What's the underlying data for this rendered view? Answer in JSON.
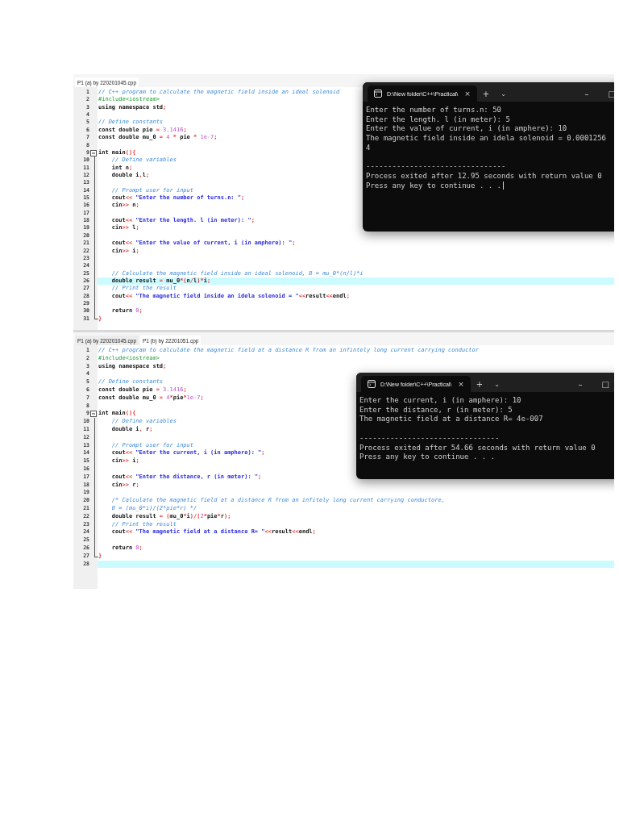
{
  "editors": [
    {
      "tabs": [
        {
          "label": "P1 (a) by 220201045.cpp",
          "selected": true
        }
      ],
      "lines": [
        {
          "number": "1",
          "highlighted": false,
          "segments": [
            {
              "kind": "comment",
              "text": "// C++ program to calculate the magnetic field inside an ideal solenoid"
            }
          ]
        },
        {
          "number": "2",
          "highlighted": false,
          "segments": [
            {
              "kind": "pre",
              "text": "#include<iostream>"
            }
          ]
        },
        {
          "number": "3",
          "highlighted": false,
          "segments": [
            {
              "kind": "plain",
              "text": "using namespace std"
            },
            {
              "kind": "op",
              "text": ";"
            }
          ]
        },
        {
          "number": "4",
          "highlighted": false
        },
        {
          "number": "5",
          "highlighted": false,
          "segments": [
            {
              "kind": "comment",
              "text": "// Define constants"
            }
          ]
        },
        {
          "number": "6",
          "highlighted": false,
          "segments": [
            {
              "kind": "plain",
              "text": "const double pie "
            },
            {
              "kind": "op",
              "text": "="
            },
            {
              "kind": "num",
              "text": " 3.1416"
            },
            {
              "kind": "op",
              "text": ";"
            }
          ]
        },
        {
          "number": "7",
          "highlighted": false,
          "segments": [
            {
              "kind": "plain",
              "text": "const double mu_0 "
            },
            {
              "kind": "op",
              "text": "="
            },
            {
              "kind": "num",
              "text": " 4 "
            },
            {
              "kind": "op",
              "text": "*"
            },
            {
              "kind": "plain",
              "text": " pie "
            },
            {
              "kind": "op",
              "text": "*"
            },
            {
              "kind": "num",
              "text": " 1e-7"
            },
            {
              "kind": "op",
              "text": ";"
            }
          ]
        },
        {
          "number": "8",
          "highlighted": false
        },
        {
          "number": "9",
          "highlighted": false,
          "kind": "fold_start",
          "segments": [
            {
              "kind": "plain",
              "text": "int main"
            },
            {
              "kind": "op",
              "text": "(){"
            }
          ]
        },
        {
          "number": "10",
          "highlighted": false,
          "segments": [
            {
              "kind": "comment",
              "text": "    // Define variables"
            }
          ]
        },
        {
          "number": "11",
          "highlighted": false,
          "segments": [
            {
              "kind": "plain",
              "text": "    int n"
            },
            {
              "kind": "op",
              "text": ";"
            }
          ]
        },
        {
          "number": "12",
          "highlighted": false,
          "segments": [
            {
              "kind": "plain",
              "text": "    double i"
            },
            {
              "kind": "op",
              "text": ","
            },
            {
              "kind": "plain",
              "text": "l"
            },
            {
              "kind": "op",
              "text": ";"
            }
          ]
        },
        {
          "number": "13",
          "highlighted": false
        },
        {
          "number": "14",
          "highlighted": false,
          "segments": [
            {
              "kind": "comment",
              "text": "    // Prompt user for input"
            }
          ]
        },
        {
          "number": "15",
          "highlighted": false,
          "segments": [
            {
              "kind": "plain",
              "text": "    cout"
            },
            {
              "kind": "op",
              "text": "<<"
            },
            {
              "kind": "str",
              "text": " \"Enter the number of turns.n: \""
            },
            {
              "kind": "op",
              "text": ";"
            }
          ]
        },
        {
          "number": "16",
          "highlighted": false,
          "segments": [
            {
              "kind": "plain",
              "text": "    cin"
            },
            {
              "kind": "op",
              "text": ">>"
            },
            {
              "kind": "plain",
              "text": " n"
            },
            {
              "kind": "op",
              "text": ";"
            }
          ]
        },
        {
          "number": "17",
          "highlighted": false
        },
        {
          "number": "18",
          "highlighted": false,
          "segments": [
            {
              "kind": "plain",
              "text": "    cout"
            },
            {
              "kind": "op",
              "text": "<<"
            },
            {
              "kind": "str",
              "text": " \"Enter the length. l (in meter): \""
            },
            {
              "kind": "op",
              "text": ";"
            }
          ]
        },
        {
          "number": "19",
          "highlighted": false,
          "segments": [
            {
              "kind": "plain",
              "text": "    cin"
            },
            {
              "kind": "op",
              "text": ">>"
            },
            {
              "kind": "plain",
              "text": " l"
            },
            {
              "kind": "op",
              "text": ";"
            }
          ]
        },
        {
          "number": "20",
          "highlighted": false
        },
        {
          "number": "21",
          "highlighted": false,
          "segments": [
            {
              "kind": "plain",
              "text": "    cout"
            },
            {
              "kind": "op",
              "text": "<<"
            },
            {
              "kind": "str",
              "text": " \"Enter the value of current, i (in amphere): \""
            },
            {
              "kind": "op",
              "text": ";"
            }
          ]
        },
        {
          "number": "22",
          "highlighted": false,
          "segments": [
            {
              "kind": "plain",
              "text": "    cin"
            },
            {
              "kind": "op",
              "text": ">>"
            },
            {
              "kind": "plain",
              "text": " i"
            },
            {
              "kind": "op",
              "text": ";"
            }
          ]
        },
        {
          "number": "23",
          "highlighted": false
        },
        {
          "number": "24",
          "highlighted": false
        },
        {
          "number": "25",
          "highlighted": false,
          "segments": [
            {
              "kind": "comment",
              "text": "    // Calculate the magnetic field inside an ideal solenoid, B = mu_0*(n/l)*i"
            }
          ]
        },
        {
          "number": "26",
          "highlighted": true,
          "segments": [
            {
              "kind": "plain",
              "text": "    double result "
            },
            {
              "kind": "op",
              "text": "="
            },
            {
              "kind": "plain",
              "text": " mu_0"
            },
            {
              "kind": "op",
              "text": "*("
            },
            {
              "kind": "plain",
              "text": "n"
            },
            {
              "kind": "op",
              "text": "/"
            },
            {
              "kind": "plain",
              "text": "l"
            },
            {
              "kind": "op",
              "text": ")*"
            },
            {
              "kind": "plain",
              "text": "i"
            },
            {
              "kind": "op",
              "text": ";"
            }
          ]
        },
        {
          "number": "27",
          "highlighted": false,
          "segments": [
            {
              "kind": "comment",
              "text": "    // Print the result"
            }
          ]
        },
        {
          "number": "28",
          "highlighted": false,
          "segments": [
            {
              "kind": "plain",
              "text": "    cout"
            },
            {
              "kind": "op",
              "text": "<<"
            },
            {
              "kind": "str",
              "text": " \"The magnetic field inside an idela solenoid = \""
            },
            {
              "kind": "op",
              "text": "<<"
            },
            {
              "kind": "plain",
              "text": "result"
            },
            {
              "kind": "op",
              "text": "<<"
            },
            {
              "kind": "plain",
              "text": "endl"
            },
            {
              "kind": "op",
              "text": ";"
            }
          ]
        },
        {
          "number": "29",
          "highlighted": false
        },
        {
          "number": "30",
          "highlighted": false,
          "segments": [
            {
              "kind": "plain",
              "text": "    return "
            },
            {
              "kind": "num",
              "text": "0"
            },
            {
              "kind": "op",
              "text": ";"
            }
          ]
        },
        {
          "number": "31",
          "highlighted": false,
          "kind": "fold_end",
          "segments": [
            {
              "kind": "op",
              "text": "}"
            }
          ]
        }
      ],
      "terminal": {
        "title": "D:\\New folder\\C++\\Practical\\",
        "close": "×",
        "new_tab": "+",
        "dropdown": "⌄",
        "minimize": "–",
        "maximize": "□",
        "cursor": true,
        "lines": [
          {
            "kind": "output",
            "text": "Enter the number of turns.n: 50"
          },
          {
            "kind": "output",
            "text": "Enter the length. l (in meter): 5"
          },
          {
            "kind": "output",
            "text": "Enter the value of current, i (in amphere): 10"
          },
          {
            "kind": "output",
            "text": "The magnetic field inside an idela solenoid = 0.0001256"
          },
          {
            "kind": "output",
            "text": "4"
          },
          {
            "kind": "separator",
            "text": "--------------------------------"
          },
          {
            "kind": "output",
            "text": "Process exited after 12.95 seconds with return value 0"
          },
          {
            "kind": "output",
            "text": "Press any key to continue . . ."
          }
        ]
      }
    },
    {
      "tabs": [
        {
          "label": "P1 (a) by 220201045.cpp",
          "selected": false
        },
        {
          "label": "P1 (b) by 22201051.cpp",
          "selected": true
        }
      ],
      "lines": [
        {
          "number": "1",
          "highlighted": false,
          "segments": [
            {
              "kind": "comment",
              "text": "// C++ program to calculate the magnetic field at a distance R from an infintely long current carrying conductor"
            }
          ]
        },
        {
          "number": "2",
          "highlighted": false,
          "segments": [
            {
              "kind": "pre",
              "text": "#include<iostream>"
            }
          ]
        },
        {
          "number": "3",
          "highlighted": false,
          "segments": [
            {
              "kind": "plain",
              "text": "using namespace std"
            },
            {
              "kind": "op",
              "text": ";"
            }
          ]
        },
        {
          "number": "4",
          "highlighted": false
        },
        {
          "number": "5",
          "highlighted": false,
          "segments": [
            {
              "kind": "comment",
              "text": "// Define constants"
            }
          ]
        },
        {
          "number": "6",
          "highlighted": false,
          "segments": [
            {
              "kind": "plain",
              "text": "const double pie "
            },
            {
              "kind": "op",
              "text": "="
            },
            {
              "kind": "num",
              "text": " 3.1416"
            },
            {
              "kind": "op",
              "text": ";"
            }
          ]
        },
        {
          "number": "7",
          "highlighted": false,
          "segments": [
            {
              "kind": "plain",
              "text": "const double mu_0 "
            },
            {
              "kind": "op",
              "text": "="
            },
            {
              "kind": "num",
              "text": " 4"
            },
            {
              "kind": "op",
              "text": "*"
            },
            {
              "kind": "plain",
              "text": "pie"
            },
            {
              "kind": "op",
              "text": "*"
            },
            {
              "kind": "num",
              "text": "1e-7"
            },
            {
              "kind": "op",
              "text": ";"
            }
          ]
        },
        {
          "number": "8",
          "highlighted": false
        },
        {
          "number": "9",
          "highlighted": false,
          "kind": "fold_start",
          "segments": [
            {
              "kind": "plain",
              "text": "int main"
            },
            {
              "kind": "op",
              "text": "(){"
            }
          ]
        },
        {
          "number": "10",
          "highlighted": false,
          "segments": [
            {
              "kind": "comment",
              "text": "    // Define variables"
            }
          ]
        },
        {
          "number": "11",
          "highlighted": false,
          "segments": [
            {
              "kind": "plain",
              "text": "    double i"
            },
            {
              "kind": "op",
              "text": ","
            },
            {
              "kind": "plain",
              "text": " r"
            },
            {
              "kind": "op",
              "text": ";"
            }
          ]
        },
        {
          "number": "12",
          "highlighted": false
        },
        {
          "number": "13",
          "highlighted": false,
          "segments": [
            {
              "kind": "comment",
              "text": "    // Prompt user for input"
            }
          ]
        },
        {
          "number": "14",
          "highlighted": false,
          "segments": [
            {
              "kind": "plain",
              "text": "    cout"
            },
            {
              "kind": "op",
              "text": "<<"
            },
            {
              "kind": "str",
              "text": " \"Enter the current, i (in amphere): \""
            },
            {
              "kind": "op",
              "text": ";"
            }
          ]
        },
        {
          "number": "15",
          "highlighted": false,
          "segments": [
            {
              "kind": "plain",
              "text": "    cin"
            },
            {
              "kind": "op",
              "text": ">>"
            },
            {
              "kind": "plain",
              "text": " i"
            },
            {
              "kind": "op",
              "text": ";"
            }
          ]
        },
        {
          "number": "16",
          "highlighted": false
        },
        {
          "number": "17",
          "highlighted": false,
          "segments": [
            {
              "kind": "plain",
              "text": "    cout"
            },
            {
              "kind": "op",
              "text": "<<"
            },
            {
              "kind": "str",
              "text": " \"Enter the distance, r (in meter): \""
            },
            {
              "kind": "op",
              "text": ";"
            }
          ]
        },
        {
          "number": "18",
          "highlighted": false,
          "segments": [
            {
              "kind": "plain",
              "text": "    cin"
            },
            {
              "kind": "op",
              "text": ">>"
            },
            {
              "kind": "plain",
              "text": " r"
            },
            {
              "kind": "op",
              "text": ";"
            }
          ]
        },
        {
          "number": "19",
          "highlighted": false
        },
        {
          "number": "20",
          "highlighted": false,
          "segments": [
            {
              "kind": "comment",
              "text": "    /* Calculate the magnetic field at a distance R from an infitely long current carrying conductore,"
            }
          ]
        },
        {
          "number": "21",
          "highlighted": false,
          "segments": [
            {
              "kind": "comment",
              "text": "    B = (mu_0*i)/(2*pie*r) */"
            }
          ]
        },
        {
          "number": "22",
          "highlighted": false,
          "segments": [
            {
              "kind": "plain",
              "text": "    double result "
            },
            {
              "kind": "op",
              "text": "= ("
            },
            {
              "kind": "plain",
              "text": "mu_0"
            },
            {
              "kind": "op",
              "text": "*"
            },
            {
              "kind": "plain",
              "text": "i"
            },
            {
              "kind": "op",
              "text": ")/("
            },
            {
              "kind": "num",
              "text": "2"
            },
            {
              "kind": "op",
              "text": "*"
            },
            {
              "kind": "plain",
              "text": "pie"
            },
            {
              "kind": "op",
              "text": "*"
            },
            {
              "kind": "plain",
              "text": "r"
            },
            {
              "kind": "op",
              "text": ");"
            }
          ]
        },
        {
          "number": "23",
          "highlighted": false,
          "segments": [
            {
              "kind": "comment",
              "text": "    // Print the result"
            }
          ]
        },
        {
          "number": "24",
          "highlighted": false,
          "segments": [
            {
              "kind": "plain",
              "text": "    cout"
            },
            {
              "kind": "op",
              "text": "<<"
            },
            {
              "kind": "str",
              "text": " \"The magnetic field at a distance R= \""
            },
            {
              "kind": "op",
              "text": "<<"
            },
            {
              "kind": "plain",
              "text": "result"
            },
            {
              "kind": "op",
              "text": "<<"
            },
            {
              "kind": "plain",
              "text": "endl"
            },
            {
              "kind": "op",
              "text": ";"
            }
          ]
        },
        {
          "number": "25",
          "highlighted": false
        },
        {
          "number": "26",
          "highlighted": false,
          "segments": [
            {
              "kind": "plain",
              "text": "    return "
            },
            {
              "kind": "num",
              "text": "0"
            },
            {
              "kind": "op",
              "text": ";"
            }
          ]
        },
        {
          "number": "27",
          "highlighted": false,
          "kind": "fold_end",
          "segments": [
            {
              "kind": "op",
              "text": "}"
            }
          ]
        },
        {
          "number": "28",
          "highlighted": true
        }
      ],
      "terminal": {
        "title": "D:\\New folder\\C++\\Practical\\",
        "close": "×",
        "new_tab": "+",
        "dropdown": "⌄",
        "minimize": "–",
        "maximize": "□",
        "cursor": false,
        "lines": [
          {
            "kind": "output",
            "text": "Enter the current, i (in amphere): 10"
          },
          {
            "kind": "output",
            "text": "Enter the distance, r (in meter): 5"
          },
          {
            "kind": "output",
            "text": "The magnetic field at a distance R= 4e-007"
          },
          {
            "kind": "separator",
            "text": "--------------------------------"
          },
          {
            "kind": "output",
            "text": "Process exited after 54.66 seconds with return value 0"
          },
          {
            "kind": "output",
            "text": "Press any key to continue . . ."
          }
        ]
      }
    }
  ]
}
